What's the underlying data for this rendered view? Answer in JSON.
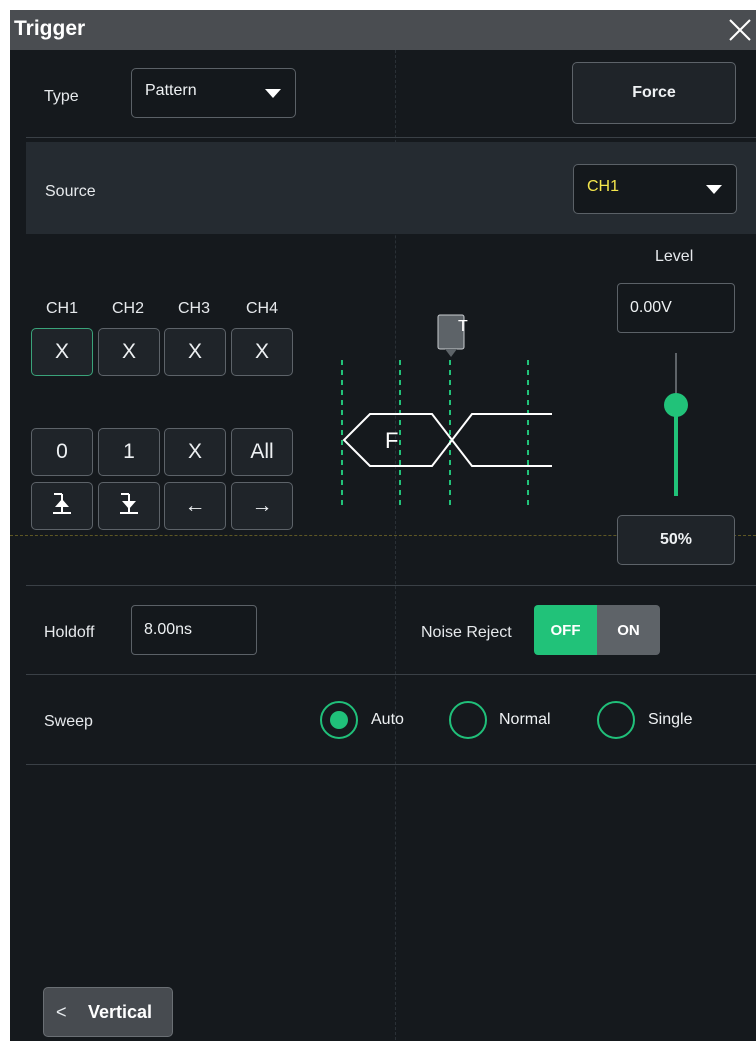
{
  "window": {
    "title": "Trigger",
    "close_icon": "close-icon"
  },
  "type_row": {
    "label": "Type",
    "value": "Pattern",
    "force_label": "Force"
  },
  "source_row": {
    "label": "Source",
    "value": "CH1",
    "value_color": "#f4e64c"
  },
  "pattern": {
    "channels": [
      "CH1",
      "CH2",
      "CH3",
      "CH4"
    ],
    "channel_values": [
      "X",
      "X",
      "X",
      "X"
    ],
    "selected_channel": "CH1",
    "keys": [
      "0",
      "1",
      "X",
      "All"
    ],
    "nav_icons": [
      "rising-edge-icon",
      "falling-edge-icon",
      "left-arrow-icon",
      "right-arrow-icon"
    ],
    "nav_glyphs": [
      "",
      "",
      "←",
      "→"
    ],
    "diagram_letter": "F",
    "trigger_marker": "T"
  },
  "level": {
    "label": "Level",
    "value": "0.00V",
    "percent_label": "50%",
    "slider_fraction": 0.5
  },
  "holdoff": {
    "label": "Holdoff",
    "value": "8.00ns"
  },
  "noise_reject": {
    "label": "Noise Reject",
    "off_label": "OFF",
    "on_label": "ON",
    "state": "OFF"
  },
  "sweep": {
    "label": "Sweep",
    "options": [
      "Auto",
      "Normal",
      "Single"
    ],
    "selected": "Auto"
  },
  "footer": {
    "back_label": "Vertical",
    "back_icon": "chevron-left-icon",
    "back_glyph": "<"
  },
  "colors": {
    "accent": "#20c07a",
    "panel": "#15191d",
    "titlebar": "#4a4d51"
  }
}
